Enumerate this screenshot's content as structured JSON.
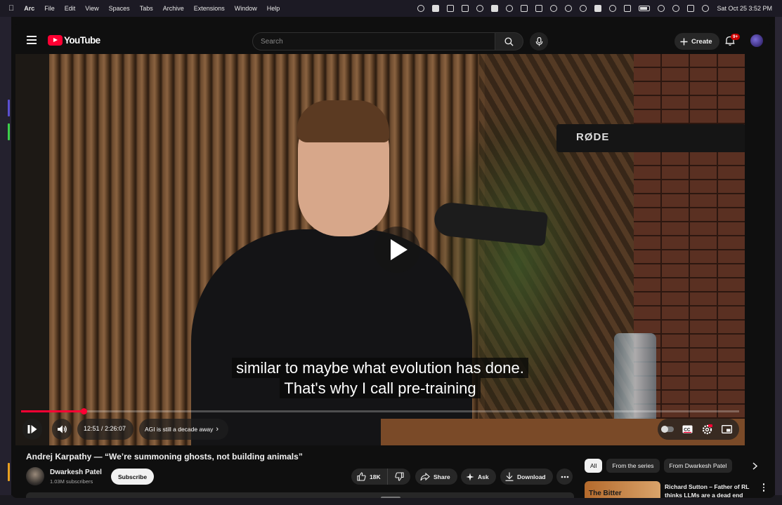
{
  "menubar": {
    "apple": "",
    "app": "Arc",
    "items": [
      "File",
      "Edit",
      "View",
      "Spaces",
      "Tabs",
      "Archive",
      "Extensions",
      "Window",
      "Help"
    ],
    "datetime": "Sat Oct 25  3:52 PM"
  },
  "header": {
    "logo_text": "YouTube",
    "search_placeholder": "Search",
    "create_label": "Create",
    "notification_badge": "9+"
  },
  "player": {
    "caption_line1": "similar to maybe what evolution has done.",
    "caption_line2": "That's why I call pre-training",
    "current_time": "12:51",
    "duration": "2:26:07",
    "time_display": "12:51 / 2:26:07",
    "progress_fraction": 0.0879,
    "chapter": "AGI is still a decade away",
    "chapter_arrow": "›",
    "accent": "#ff0033"
  },
  "video": {
    "title": "Andrej Karpathy — “We’re summoning ghosts, not building animals”",
    "channel": "Dwarkesh Patel",
    "subscribers": "1.03M subscribers",
    "subscribe_label": "Subscribe",
    "likes": "18K",
    "share_label": "Share",
    "ask_label": "Ask",
    "download_label": "Download"
  },
  "sidebar": {
    "chips": [
      "All",
      "From the series",
      "From Dwarkesh Patel"
    ],
    "recommendation": {
      "thumb_text": "The Bitter",
      "title": "Richard Sutton – Father of RL thinks LLMs are a dead end"
    }
  }
}
